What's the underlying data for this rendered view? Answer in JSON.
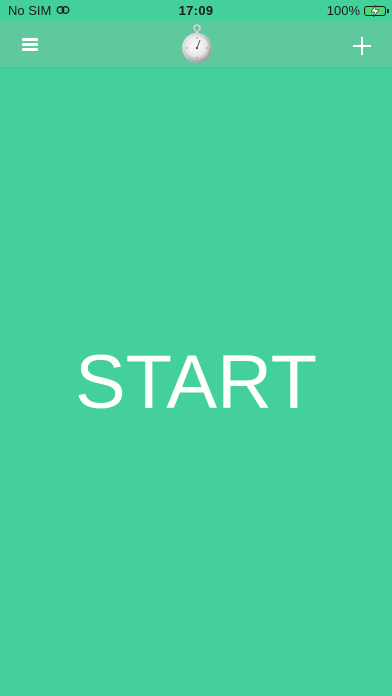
{
  "status_bar": {
    "carrier": "No SIM",
    "wifi_icon": "wifi-icon",
    "time": "17:09",
    "battery_percent": "100%",
    "battery_level": 1.0,
    "battery_color": "#4cd964",
    "charging_icon": "charging-bolt-icon"
  },
  "nav_bar": {
    "menu_icon": "hamburger-menu-icon",
    "logo_icon": "stopwatch-icon",
    "add_icon": "plus-icon"
  },
  "main": {
    "start_label": "START",
    "background_color": "#44d09a"
  }
}
